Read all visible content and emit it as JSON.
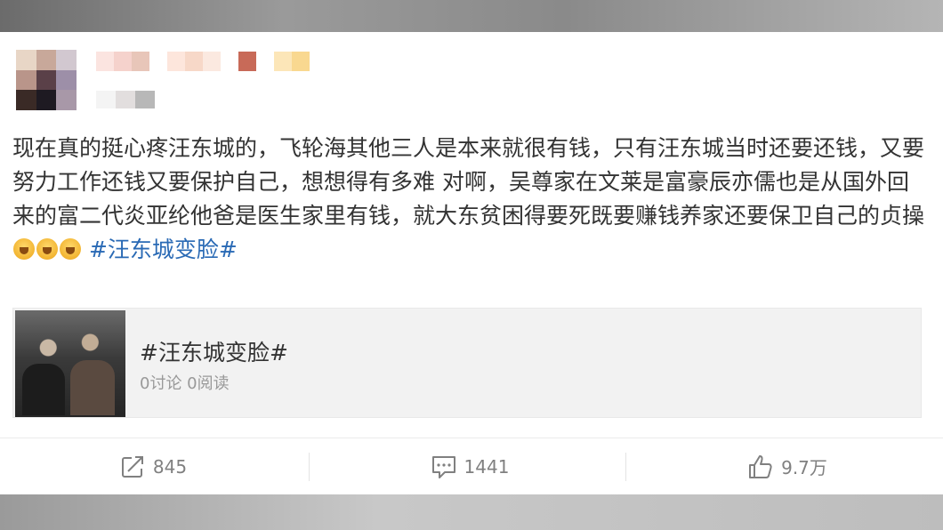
{
  "post": {
    "text_main": "现在真的挺心疼汪东城的，飞轮海其他三人是本来就很有钱，只有汪东城当时还要还钱，又要努力工作还钱又要保护自己，想想得有多难 对啊，吴尊家在文莱是富豪辰亦儒也是从国外回来的富二代炎亚纶他爸是医生家里有钱，就大东贫困得要死既要赚钱养家还要保卫自己的贞操",
    "emojis": [
      "crying-emoji",
      "crying-emoji",
      "crying-emoji"
    ],
    "hashtag": "#汪东城变脸#"
  },
  "topic_card": {
    "title": "#汪东城变脸#",
    "stats": "0讨论 0阅读"
  },
  "actions": {
    "repost": {
      "icon": "share-icon",
      "count": "845"
    },
    "comment": {
      "icon": "comment-icon",
      "count": "1441"
    },
    "like": {
      "icon": "thumbs-up-icon",
      "count": "9.7万"
    }
  },
  "colors": {
    "link": "#2a6ab5",
    "text": "#333333",
    "muted": "#808080"
  }
}
